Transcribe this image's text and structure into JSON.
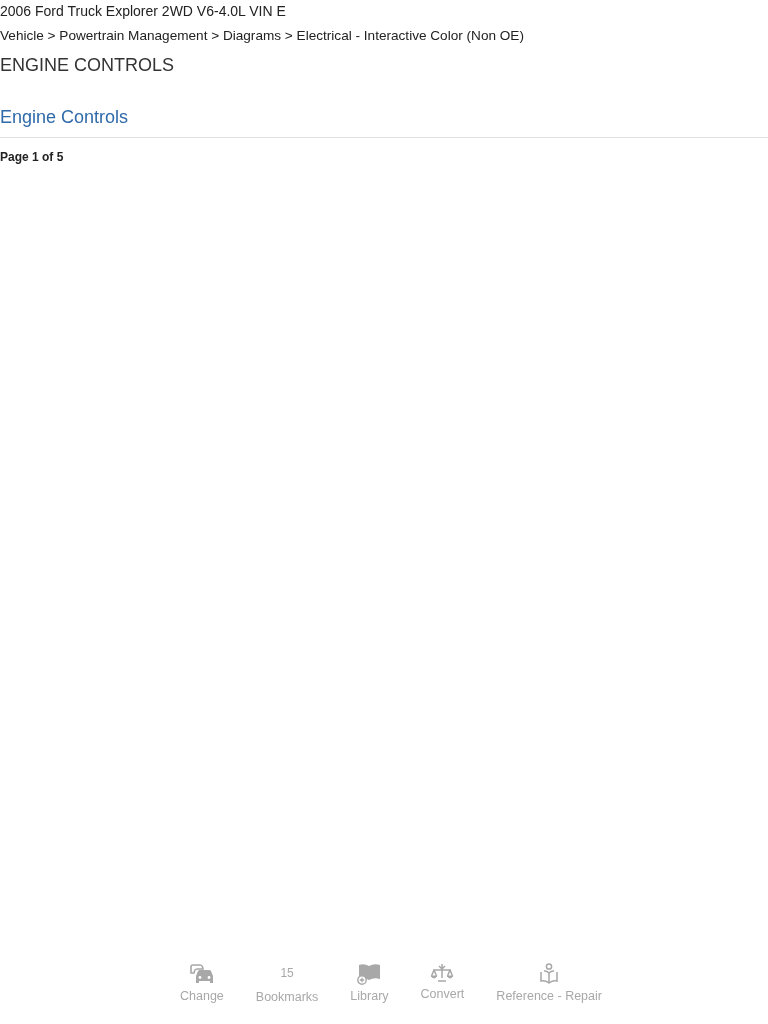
{
  "header": {
    "vehicle": "2006 Ford Truck Explorer 2WD V6-4.0L VIN E",
    "breadcrumb": "Vehicle > Powertrain Management > Diagrams > Electrical - Interactive Color (Non OE)",
    "section_title": "ENGINE CONTROLS"
  },
  "document": {
    "title": "Engine Controls",
    "page_indicator": "Page 1 of 5"
  },
  "toolbar": {
    "items": [
      {
        "kind": "icon",
        "label": "Change"
      },
      {
        "kind": "count",
        "count": "15",
        "label": "Bookmarks"
      },
      {
        "kind": "icon",
        "label": "Library"
      },
      {
        "kind": "icon",
        "label": "Convert"
      },
      {
        "kind": "icon",
        "label": "Reference - Repair"
      }
    ]
  }
}
